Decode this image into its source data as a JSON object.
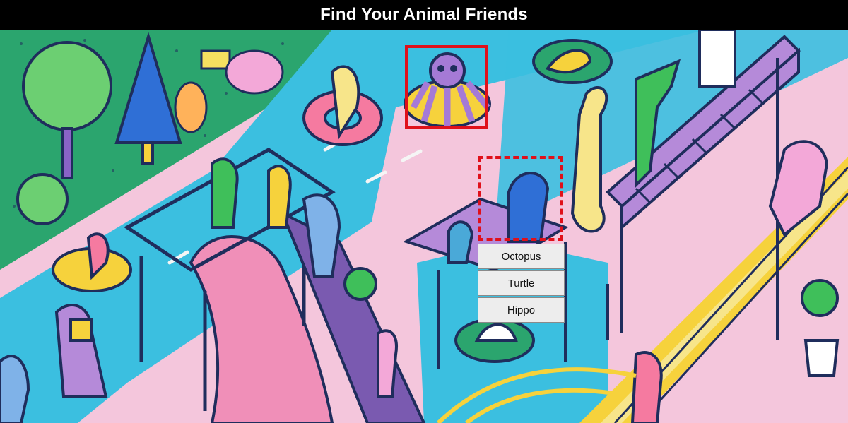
{
  "header": {
    "title": "Find Your Animal Friends"
  },
  "game": {
    "found_animal_box": {
      "style": "solid",
      "color": "#e0101a"
    },
    "target_animal_box": {
      "style": "dashed",
      "color": "#e0101a"
    },
    "choices": [
      "Octopus",
      "Turtle",
      "Hippo"
    ]
  },
  "colors": {
    "grass": "#2ba56e",
    "pool": "#3bbfe0",
    "deck": "#f4c6dc",
    "slide": "#f08fb8",
    "outline": "#1f2d5c",
    "purple": "#9b6bc9",
    "rail_yellow": "#f6d23c"
  }
}
